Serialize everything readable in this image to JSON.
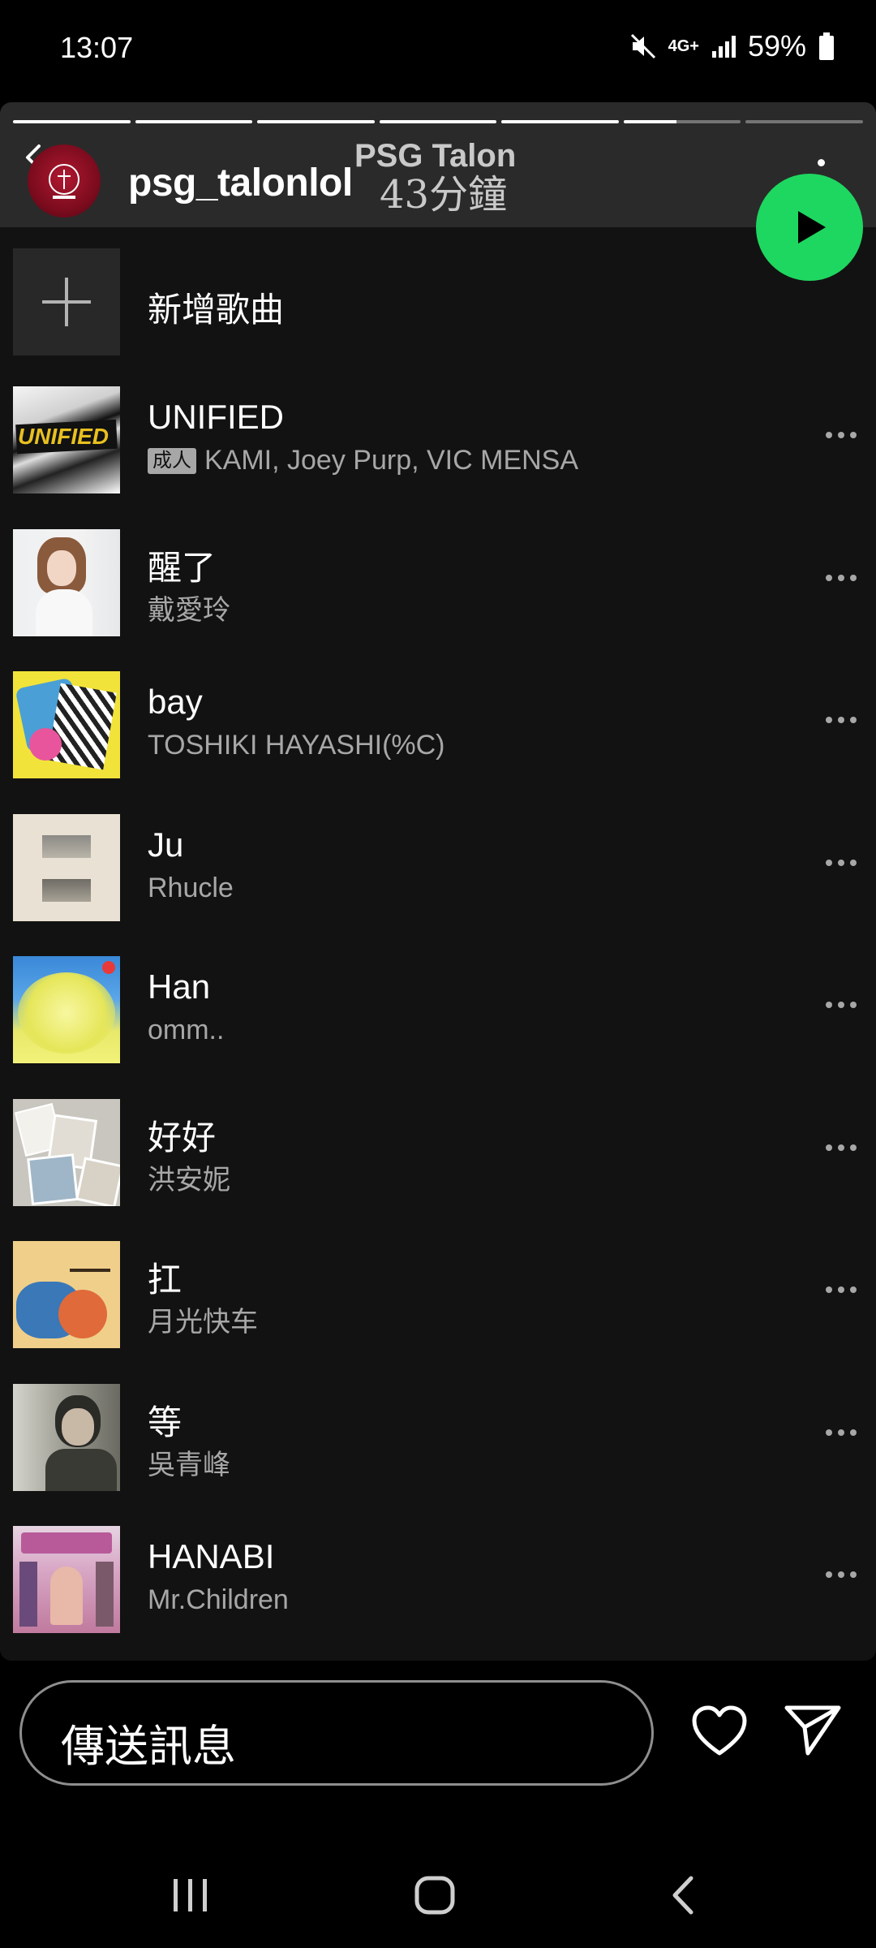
{
  "status": {
    "time": "13:07",
    "network": "4G+",
    "battery": "59%"
  },
  "story": {
    "username": "psg_talonlol",
    "playlist_title": "PSG Talon",
    "duration": "43分鐘",
    "progress": [
      1,
      1,
      1,
      1,
      1,
      0.45,
      0
    ]
  },
  "add_song_label": "新增歌曲",
  "tracks": [
    {
      "title": "UNIFIED",
      "artist": "KAMI, Joey Purp, VIC MENSA",
      "explicit": "成人"
    },
    {
      "title": "醒了",
      "artist": "戴愛玲"
    },
    {
      "title": "bay",
      "artist": "TOSHIKI HAYASHI(%C)"
    },
    {
      "title": "Ju",
      "artist": "Rhucle"
    },
    {
      "title": "Han",
      "artist": "omm.."
    },
    {
      "title": "好好",
      "artist": "洪安妮"
    },
    {
      "title": "扛",
      "artist": "月光快车"
    },
    {
      "title": "等",
      "artist": "吳青峰"
    },
    {
      "title": "HANABI",
      "artist": "Mr.Children"
    }
  ],
  "message": {
    "placeholder": "傳送訊息"
  },
  "colors": {
    "accent_green": "#1ed760",
    "background": "#121212",
    "header": "#2a2a2a"
  }
}
